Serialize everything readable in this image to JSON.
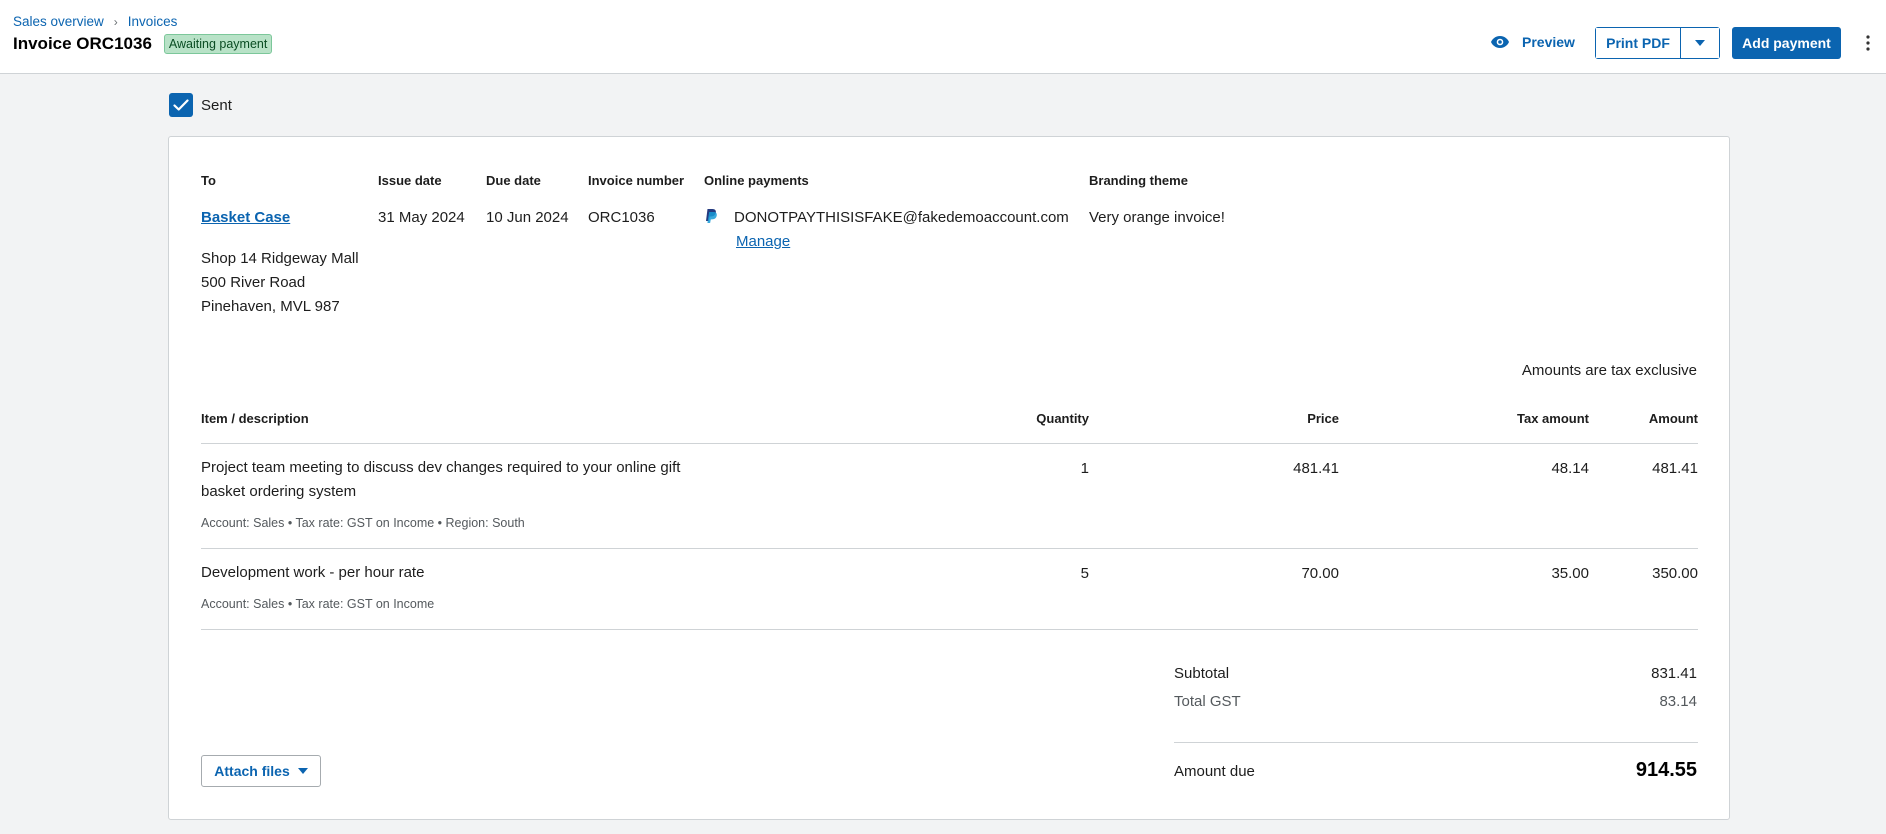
{
  "breadcrumb": {
    "items": [
      "Sales overview",
      "Invoices"
    ],
    "separator": "›"
  },
  "header": {
    "title": "Invoice ORC1036",
    "status": "Awaiting payment",
    "preview_label": "Preview",
    "print_label": "Print PDF",
    "add_payment_label": "Add payment"
  },
  "sent": {
    "label": "Sent",
    "checked": true
  },
  "invoice": {
    "to_label": "To",
    "contact_name": "Basket Case",
    "address": [
      "Shop 14 Ridgeway Mall",
      "500 River Road",
      "Pinehaven, MVL 987"
    ],
    "issue_date_label": "Issue date",
    "issue_date": "31 May 2024",
    "due_date_label": "Due date",
    "due_date": "10 Jun 2024",
    "invoice_number_label": "Invoice number",
    "invoice_number": "ORC1036",
    "online_payments_label": "Online payments",
    "online_payment_email": "DONOTPAYTHISISFAKE@fakedemoaccount.com",
    "manage_label": "Manage",
    "branding_theme_label": "Branding theme",
    "branding_theme": "Very orange invoice!",
    "tax_note": "Amounts are tax exclusive"
  },
  "table": {
    "headers": {
      "item": "Item / description",
      "quantity": "Quantity",
      "price": "Price",
      "tax": "Tax amount",
      "amount": "Amount"
    },
    "rows": [
      {
        "description": "Project team meeting to discuss dev changes required to your online gift basket ordering system",
        "meta": "Account: Sales • Tax rate: GST on Income • Region: South",
        "quantity": "1",
        "price": "481.41",
        "tax": "48.14",
        "amount": "481.41"
      },
      {
        "description": "Development work - per hour rate",
        "meta": "Account: Sales • Tax rate: GST on Income",
        "quantity": "5",
        "price": "70.00",
        "tax": "35.00",
        "amount": "350.00"
      }
    ]
  },
  "totals": {
    "subtotal_label": "Subtotal",
    "subtotal": "831.41",
    "gst_label": "Total GST",
    "gst": "83.14",
    "amount_due_label": "Amount due",
    "amount_due": "914.55"
  },
  "attach_label": "Attach files",
  "colors": {
    "accent": "#0b64b0",
    "status_bg": "#b8e2c7"
  }
}
